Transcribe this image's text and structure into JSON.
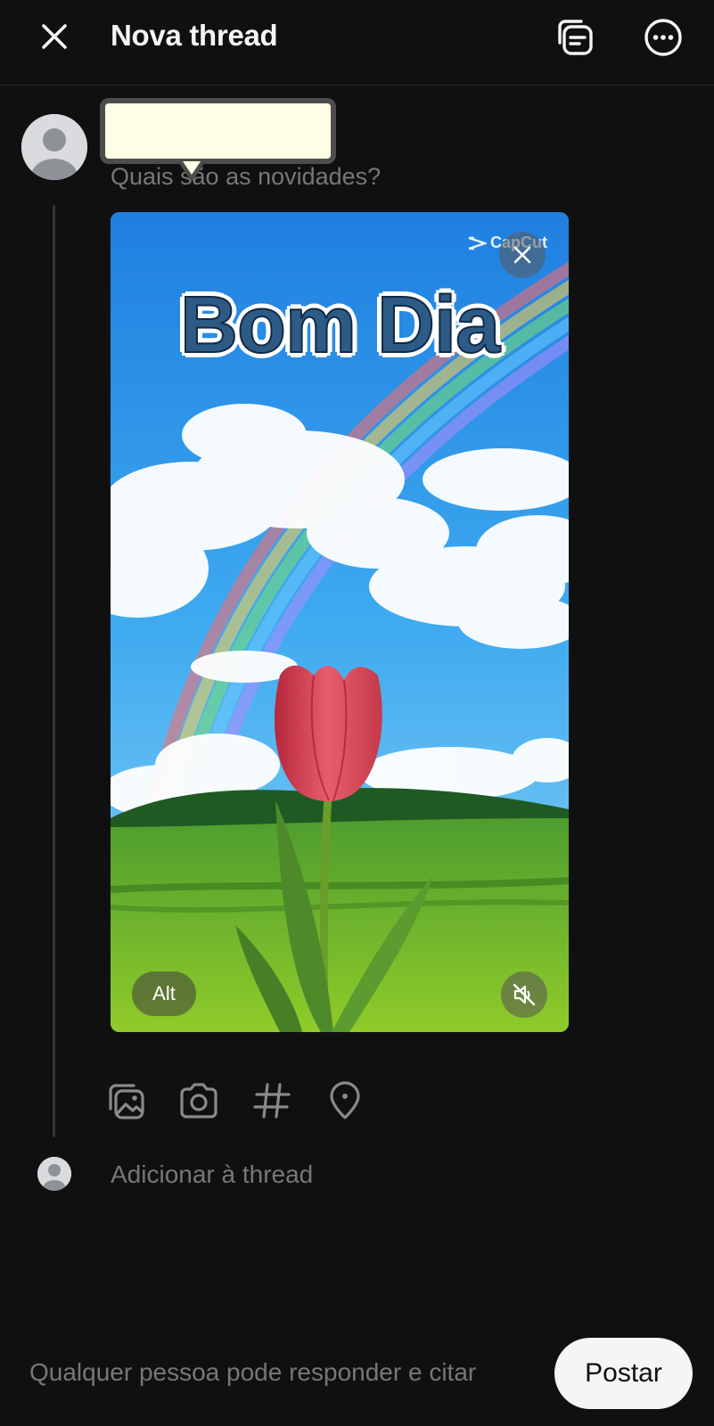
{
  "header": {
    "title": "Nova thread",
    "close_icon": "close-icon",
    "drafts_icon": "drafts-icon",
    "more_icon": "more-options-icon"
  },
  "composer": {
    "placeholder": "Quais são as novidades?",
    "avatar_icon": "default-avatar-icon"
  },
  "media": {
    "overlay_text": "Bom Dia",
    "watermark": "CapCut",
    "alt_label": "Alt",
    "remove_icon": "close-icon",
    "mute_icon": "speaker-muted-icon"
  },
  "toolbar": {
    "items": [
      {
        "name": "gallery-icon"
      },
      {
        "name": "camera-icon"
      },
      {
        "name": "hashtag-icon"
      },
      {
        "name": "location-pin-icon"
      }
    ]
  },
  "add_thread": {
    "label": "Adicionar à thread"
  },
  "footer": {
    "reply_permission": "Qualquer pessoa pode responder e citar",
    "post_label": "Postar"
  },
  "colors": {
    "background": "#101010",
    "text_primary": "#f3f5f7",
    "text_secondary": "#777777",
    "post_button_bg": "#f3f5f7"
  }
}
